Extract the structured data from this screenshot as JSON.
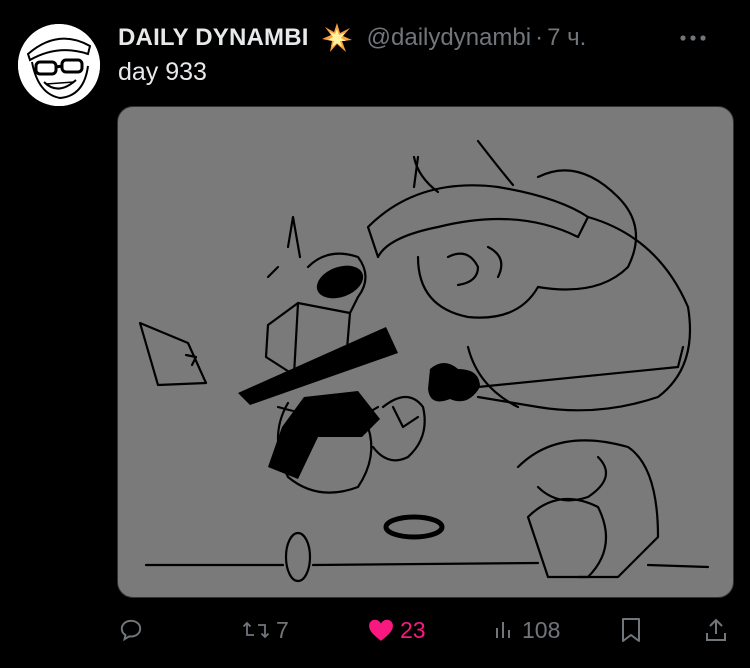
{
  "tweet": {
    "author_name": "DAILY DYNAMBI",
    "author_handle": "@dailydynambi",
    "separator": "·",
    "time_ago": "7 ч.",
    "text": "day 933",
    "name_emoji_icon": "collision-spark-icon"
  },
  "actions": {
    "reply_count": "",
    "retweet_count": "7",
    "like_count": "23",
    "view_count": "108",
    "liked": true
  },
  "colors": {
    "background": "#000000",
    "text_primary": "#e7e9ea",
    "text_secondary": "#71767b",
    "like_active": "#f91880",
    "media_background": "#7a7a7a"
  }
}
